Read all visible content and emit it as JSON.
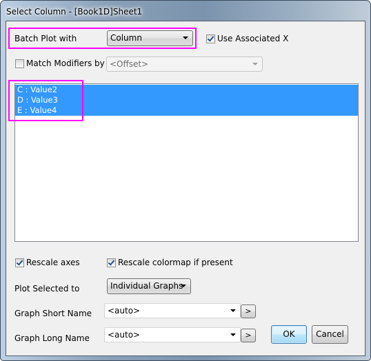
{
  "window": {
    "title": "Select Column - [Book1D]Sheet1"
  },
  "batch_plot": {
    "label": "Batch Plot with",
    "selected": "Column"
  },
  "use_associated_x": {
    "label": "Use Associated X",
    "checked": true
  },
  "match_modifiers": {
    "label": "Match Modifiers by",
    "checked": false,
    "selected": "<Offset>",
    "disabled": true
  },
  "column_list": {
    "items": [
      {
        "label": "C : Value2",
        "selected": true
      },
      {
        "label": "D : Value3",
        "selected": true
      },
      {
        "label": "E : Value4",
        "selected": true
      }
    ]
  },
  "rescale_axes": {
    "label": "Rescale axes",
    "checked": true
  },
  "rescale_colormap": {
    "label": "Rescale colormap if present",
    "checked": true
  },
  "plot_selected_to": {
    "label": "Plot Selected to",
    "selected": "Individual Graphs"
  },
  "graph_short_name": {
    "label": "Graph Short Name",
    "value": "<auto>",
    "more_button": ">"
  },
  "graph_long_name": {
    "label": "Graph Long Name",
    "value": "<auto>",
    "more_button": ">"
  },
  "buttons": {
    "ok": "OK",
    "cancel": "Cancel"
  },
  "colors": {
    "highlight_box": "#ff00ff",
    "selection": "#3399ff"
  }
}
